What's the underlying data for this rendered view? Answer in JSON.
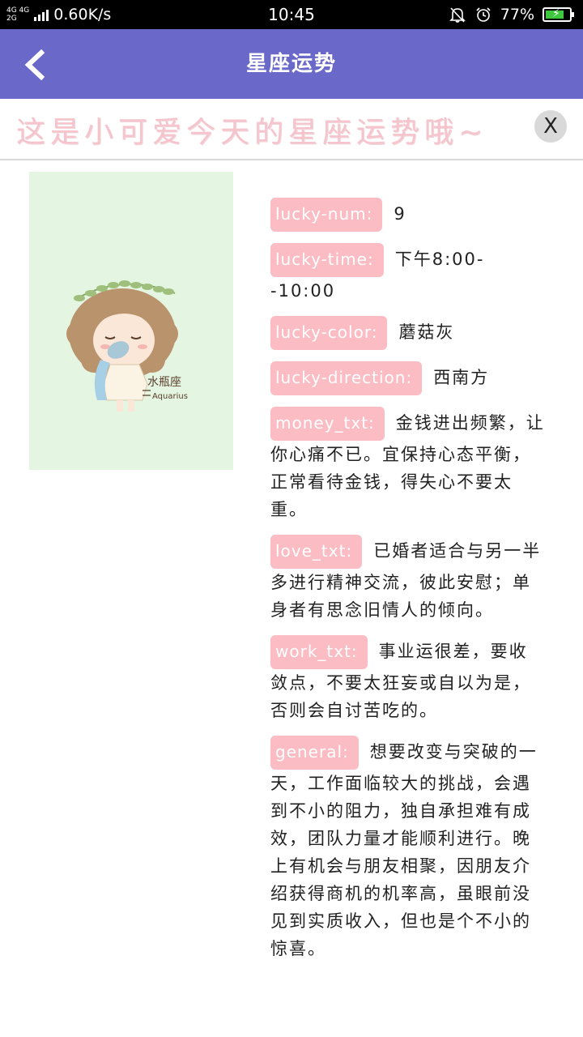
{
  "status_bar": {
    "network_top": "4G 4G",
    "network_bottom": "2G",
    "speed": "0.60K/s",
    "time": "10:45",
    "battery": "77%",
    "battery_level": 0.77
  },
  "app_bar": {
    "title": "星座运势"
  },
  "banner": {
    "text": "这是小可爱今天的星座运势哦~",
    "close_label": "X"
  },
  "image": {
    "sign_name": "水瓶座",
    "sign_name_en": "Aquarius"
  },
  "fortune": {
    "lucky_num": {
      "label": "lucky-num:",
      "value": "9"
    },
    "lucky_time": {
      "label": "lucky-time:",
      "value": "下午8:00--10:00"
    },
    "lucky_color": {
      "label": "lucky-color:",
      "value": "蘑菇灰"
    },
    "lucky_direction": {
      "label": "lucky-direction:",
      "value": "西南方"
    },
    "money_txt": {
      "label": "money_txt:",
      "value": "金钱进出频繁，让你心痛不已。宜保持心态平衡，正常看待金钱，得失心不要太重。"
    },
    "love_txt": {
      "label": "love_txt:",
      "value": "已婚者适合与另一半多进行精神交流，彼此安慰；单身者有思念旧情人的倾向。"
    },
    "work_txt": {
      "label": "work_txt:",
      "value": "事业运很差，要收敛点，不要太狂妄或自以为是，否则会自讨苦吃的。"
    },
    "general": {
      "label": "general:",
      "value": "想要改变与突破的一天，工作面临较大的挑战，会遇到不小的阻力，独自承担难有成效，团队力量才能顺利进行。晚上有机会与朋友相聚，因朋友介绍获得商机的机率高，虽眼前没见到实质收入，但也是个不小的惊喜。"
    }
  },
  "colors": {
    "app_bar": "#6a68c8",
    "label_bg": "#fbbcc4",
    "banner_text": "#f6c4cc",
    "image_bg": "#e4f5e2"
  }
}
